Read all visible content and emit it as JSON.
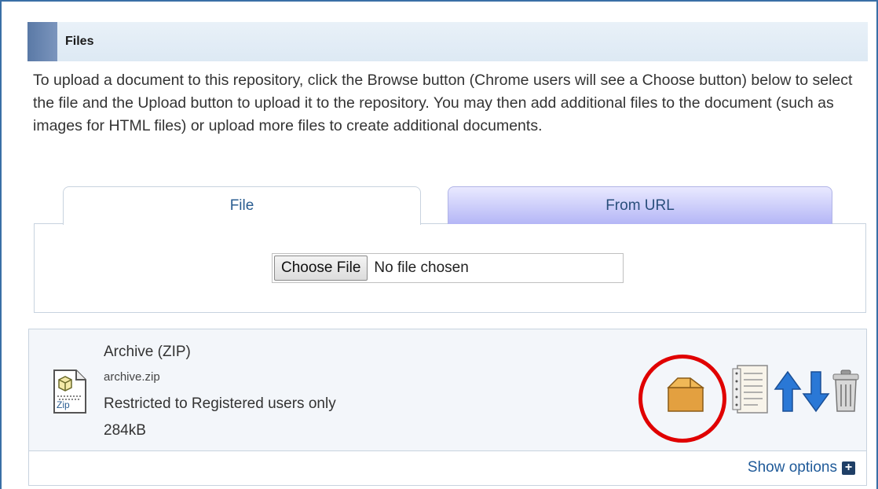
{
  "section": {
    "title": "Files"
  },
  "intro": {
    "text": "To upload a document to this repository, click the Browse button (Chrome users will see a Choose button) below to select the file and the Upload button to upload it to the repository. You may then add additional files to the document (such as images for HTML files) or upload more files to create additional documents."
  },
  "tabs": [
    {
      "label": "File",
      "active": true
    },
    {
      "label": "From URL",
      "active": false
    }
  ],
  "file_input": {
    "button_label": "Choose File",
    "status": "No file chosen"
  },
  "document": {
    "format": "Archive (ZIP)",
    "filename": "archive.zip",
    "access": "Restricted to Registered users only",
    "size": "284kB",
    "icon_label": "Zip"
  },
  "actions": [
    {
      "name": "open-archive-icon"
    },
    {
      "name": "details-icon"
    },
    {
      "name": "move-up-icon"
    },
    {
      "name": "move-down-icon"
    },
    {
      "name": "trash-icon"
    }
  ],
  "footer": {
    "show_options_label": "Show options"
  },
  "colors": {
    "accent_blue": "#1f5a99",
    "highlight_red": "#e00000",
    "tab_inactive": "#b4b6f6"
  }
}
